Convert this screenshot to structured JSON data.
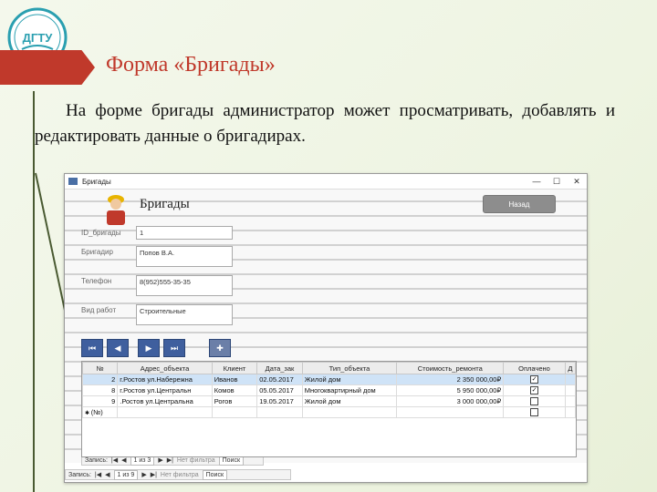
{
  "colors": {
    "accent": "#c0392b",
    "nav_button": "#3f5f9e",
    "selected_row": "#cfe3f7"
  },
  "logo": {
    "text": "ДГТУ",
    "icon": "university-logo-icon"
  },
  "slide": {
    "title": "Форма «Бригады»",
    "description": "На форме бригады администратор может просматривать, добавлять и редактировать данные о бригадирах."
  },
  "window": {
    "title": "Бригады",
    "controls": [
      "—",
      "☐",
      "✕"
    ]
  },
  "form": {
    "heading": "Бригады",
    "back_label": "Назад",
    "fields": [
      {
        "label": "ID_бригады",
        "value": "1"
      },
      {
        "label": "Бригадир",
        "value": "Попов В.А."
      },
      {
        "label": "Телефон",
        "value": "8(952)555-35-35"
      },
      {
        "label": "Вид работ",
        "value": "Строительные"
      }
    ],
    "nav": {
      "first": "⏮",
      "prev": "◀",
      "next": "▶",
      "last": "⏭",
      "new": "✚"
    }
  },
  "grid": {
    "columns": [
      "№",
      "Адрес_объекта",
      "Клиент",
      "Дата_зак",
      "Тип_объекта",
      "Стоимость_ремонта",
      "Оплачено",
      "Д"
    ],
    "rows": [
      {
        "n": "2",
        "address": "г.Ростов ул.Набережна",
        "client": "Иванов",
        "date": "02.05.2017",
        "type": "Жилой дом",
        "cost": "2 350 000,00₽",
        "paid": true
      },
      {
        "n": "8",
        "address": "г.Ростов ул.Центральн",
        "client": "Комов",
        "date": "05.05.2017",
        "type": "Многоквартирный дом",
        "cost": "5 950 000,00₽",
        "paid": true
      },
      {
        "n": "9",
        "address": ".Ростов ул.Центральна",
        "client": "Рогов",
        "date": "19.05.2017",
        "type": "Жилой дом",
        "cost": "3 000 000,00₽",
        "paid": false
      }
    ],
    "new_row": "(№)"
  },
  "inner_recbar": {
    "label": "Запись:",
    "position": "1 из 3",
    "filter": "Нет фильтра",
    "search": "Поиск"
  },
  "outer_recbar": {
    "label": "Запись:",
    "position": "1 из 9",
    "filter": "Нет фильтра",
    "search": "Поиск"
  }
}
